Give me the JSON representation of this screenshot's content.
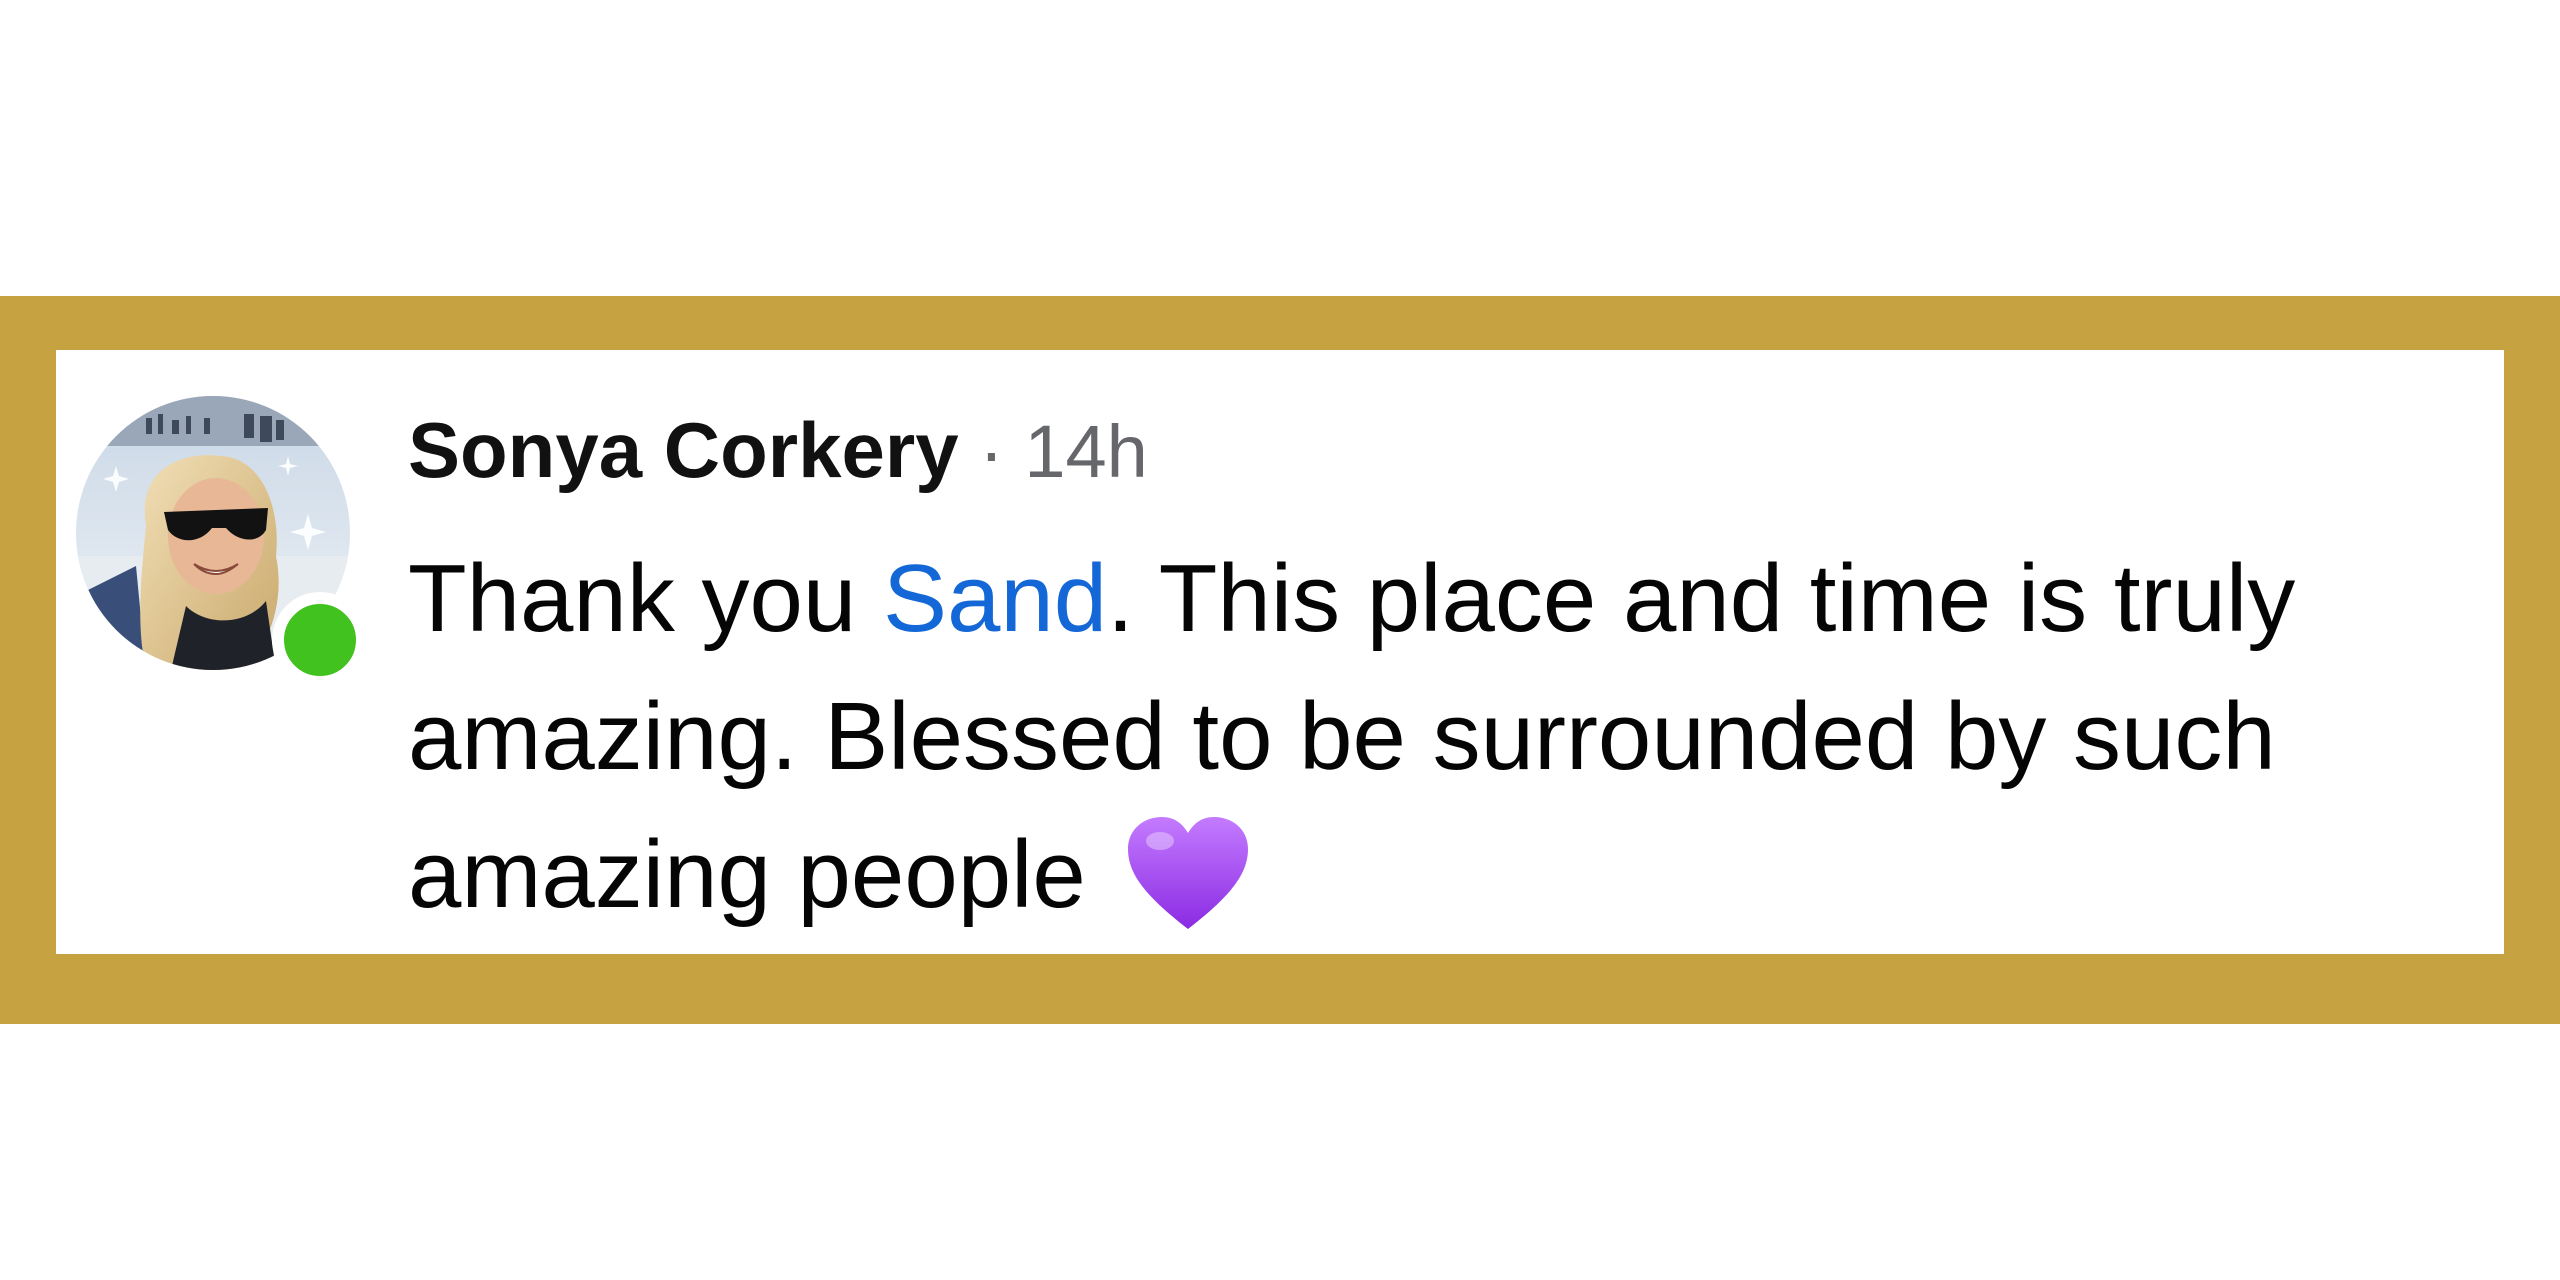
{
  "comment": {
    "author": "Sonya Corkery",
    "separator": " · ",
    "timestamp": "14h",
    "text_before_mention": "Thank you ",
    "mention": "Sand",
    "text_after_mention": ". This place and time is truly",
    "line2": "amazing. Blessed to be surrounded by such",
    "line3": "amazing people",
    "emoji": "purple-heart-icon",
    "online_status": true
  },
  "colors": {
    "frame": "#c7a241",
    "mention": "#1467d6",
    "online": "#42c21f",
    "heart": "#9b47f2",
    "meta": "#65676b"
  }
}
